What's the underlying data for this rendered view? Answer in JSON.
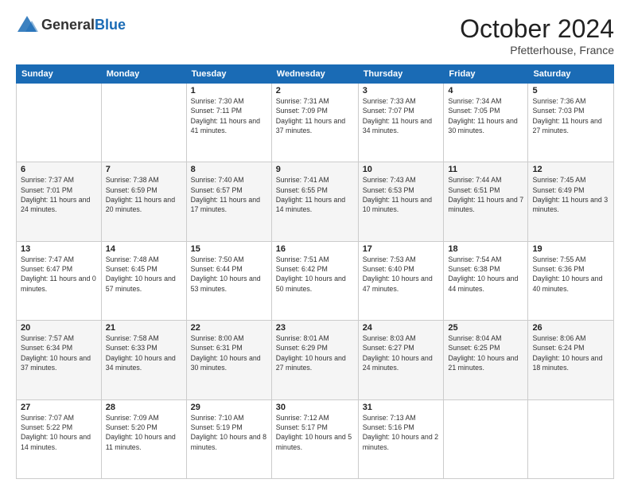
{
  "header": {
    "logo_general": "General",
    "logo_blue": "Blue",
    "month": "October 2024",
    "location": "Pfetterhouse, France"
  },
  "weekdays": [
    "Sunday",
    "Monday",
    "Tuesday",
    "Wednesday",
    "Thursday",
    "Friday",
    "Saturday"
  ],
  "weeks": [
    [
      {
        "day": "",
        "info": ""
      },
      {
        "day": "",
        "info": ""
      },
      {
        "day": "1",
        "info": "Sunrise: 7:30 AM\nSunset: 7:11 PM\nDaylight: 11 hours and 41 minutes."
      },
      {
        "day": "2",
        "info": "Sunrise: 7:31 AM\nSunset: 7:09 PM\nDaylight: 11 hours and 37 minutes."
      },
      {
        "day": "3",
        "info": "Sunrise: 7:33 AM\nSunset: 7:07 PM\nDaylight: 11 hours and 34 minutes."
      },
      {
        "day": "4",
        "info": "Sunrise: 7:34 AM\nSunset: 7:05 PM\nDaylight: 11 hours and 30 minutes."
      },
      {
        "day": "5",
        "info": "Sunrise: 7:36 AM\nSunset: 7:03 PM\nDaylight: 11 hours and 27 minutes."
      }
    ],
    [
      {
        "day": "6",
        "info": "Sunrise: 7:37 AM\nSunset: 7:01 PM\nDaylight: 11 hours and 24 minutes."
      },
      {
        "day": "7",
        "info": "Sunrise: 7:38 AM\nSunset: 6:59 PM\nDaylight: 11 hours and 20 minutes."
      },
      {
        "day": "8",
        "info": "Sunrise: 7:40 AM\nSunset: 6:57 PM\nDaylight: 11 hours and 17 minutes."
      },
      {
        "day": "9",
        "info": "Sunrise: 7:41 AM\nSunset: 6:55 PM\nDaylight: 11 hours and 14 minutes."
      },
      {
        "day": "10",
        "info": "Sunrise: 7:43 AM\nSunset: 6:53 PM\nDaylight: 11 hours and 10 minutes."
      },
      {
        "day": "11",
        "info": "Sunrise: 7:44 AM\nSunset: 6:51 PM\nDaylight: 11 hours and 7 minutes."
      },
      {
        "day": "12",
        "info": "Sunrise: 7:45 AM\nSunset: 6:49 PM\nDaylight: 11 hours and 3 minutes."
      }
    ],
    [
      {
        "day": "13",
        "info": "Sunrise: 7:47 AM\nSunset: 6:47 PM\nDaylight: 11 hours and 0 minutes."
      },
      {
        "day": "14",
        "info": "Sunrise: 7:48 AM\nSunset: 6:45 PM\nDaylight: 10 hours and 57 minutes."
      },
      {
        "day": "15",
        "info": "Sunrise: 7:50 AM\nSunset: 6:44 PM\nDaylight: 10 hours and 53 minutes."
      },
      {
        "day": "16",
        "info": "Sunrise: 7:51 AM\nSunset: 6:42 PM\nDaylight: 10 hours and 50 minutes."
      },
      {
        "day": "17",
        "info": "Sunrise: 7:53 AM\nSunset: 6:40 PM\nDaylight: 10 hours and 47 minutes."
      },
      {
        "day": "18",
        "info": "Sunrise: 7:54 AM\nSunset: 6:38 PM\nDaylight: 10 hours and 44 minutes."
      },
      {
        "day": "19",
        "info": "Sunrise: 7:55 AM\nSunset: 6:36 PM\nDaylight: 10 hours and 40 minutes."
      }
    ],
    [
      {
        "day": "20",
        "info": "Sunrise: 7:57 AM\nSunset: 6:34 PM\nDaylight: 10 hours and 37 minutes."
      },
      {
        "day": "21",
        "info": "Sunrise: 7:58 AM\nSunset: 6:33 PM\nDaylight: 10 hours and 34 minutes."
      },
      {
        "day": "22",
        "info": "Sunrise: 8:00 AM\nSunset: 6:31 PM\nDaylight: 10 hours and 30 minutes."
      },
      {
        "day": "23",
        "info": "Sunrise: 8:01 AM\nSunset: 6:29 PM\nDaylight: 10 hours and 27 minutes."
      },
      {
        "day": "24",
        "info": "Sunrise: 8:03 AM\nSunset: 6:27 PM\nDaylight: 10 hours and 24 minutes."
      },
      {
        "day": "25",
        "info": "Sunrise: 8:04 AM\nSunset: 6:25 PM\nDaylight: 10 hours and 21 minutes."
      },
      {
        "day": "26",
        "info": "Sunrise: 8:06 AM\nSunset: 6:24 PM\nDaylight: 10 hours and 18 minutes."
      }
    ],
    [
      {
        "day": "27",
        "info": "Sunrise: 7:07 AM\nSunset: 5:22 PM\nDaylight: 10 hours and 14 minutes."
      },
      {
        "day": "28",
        "info": "Sunrise: 7:09 AM\nSunset: 5:20 PM\nDaylight: 10 hours and 11 minutes."
      },
      {
        "day": "29",
        "info": "Sunrise: 7:10 AM\nSunset: 5:19 PM\nDaylight: 10 hours and 8 minutes."
      },
      {
        "day": "30",
        "info": "Sunrise: 7:12 AM\nSunset: 5:17 PM\nDaylight: 10 hours and 5 minutes."
      },
      {
        "day": "31",
        "info": "Sunrise: 7:13 AM\nSunset: 5:16 PM\nDaylight: 10 hours and 2 minutes."
      },
      {
        "day": "",
        "info": ""
      },
      {
        "day": "",
        "info": ""
      }
    ]
  ]
}
